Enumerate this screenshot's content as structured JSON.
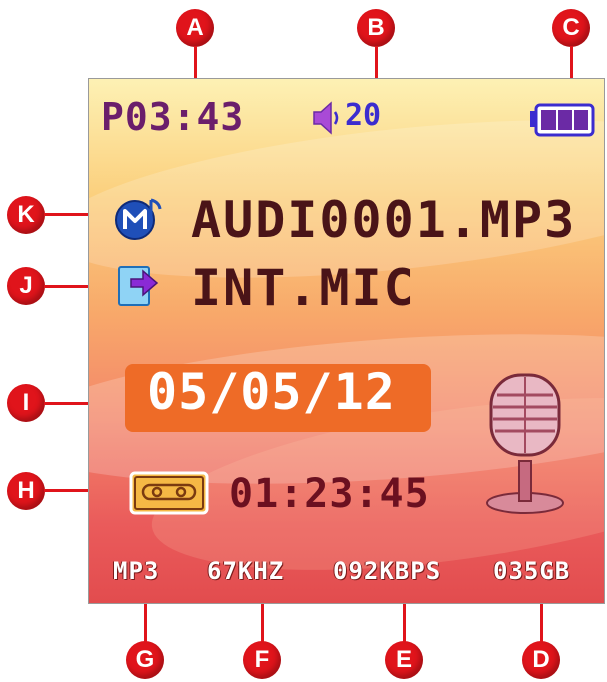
{
  "callouts": {
    "a": "A",
    "b": "B",
    "c": "C",
    "d": "D",
    "e": "E",
    "f": "F",
    "g": "G",
    "h": "H",
    "i": "I",
    "j": "J",
    "k": "K"
  },
  "screen": {
    "play_time": "P03:43",
    "volume": "20",
    "battery_level": 1.0,
    "file_name": "AUDI0001.MP3",
    "source": "INT.MIC",
    "date": "05/05/12",
    "record_time": "01:23:45",
    "format": "MP3",
    "sample_rate": "67KHZ",
    "bitrate": "092KBPS",
    "storage": "035GB"
  },
  "icons": {
    "volume": "speaker-icon",
    "battery": "battery-icon",
    "file_type": "music-file-icon",
    "source": "input-source-icon",
    "record": "cassette-icon",
    "mode": "microphone-icon"
  },
  "colors": {
    "callout": "#e0141b",
    "time_text": "#6b1e6b",
    "volume_text": "#3b2ccf",
    "date_box": "#ee6b27",
    "main_text": "#4a1418"
  }
}
